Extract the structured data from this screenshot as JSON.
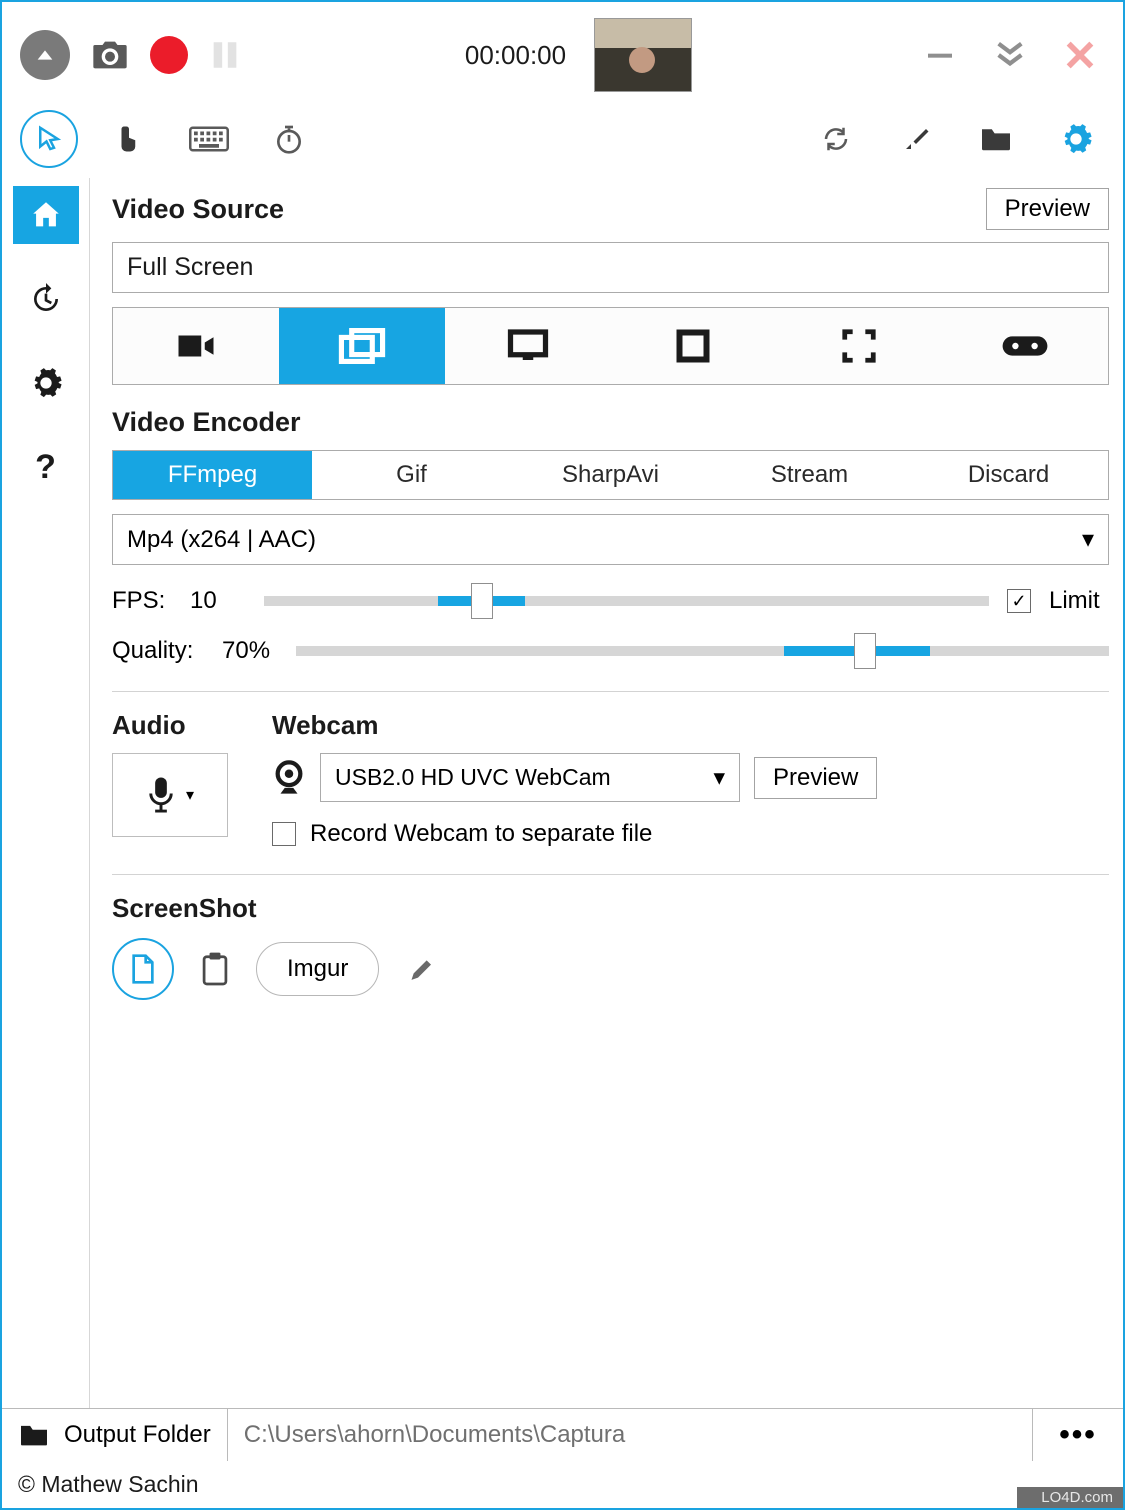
{
  "top": {
    "timer": "00:00:00"
  },
  "sections": {
    "video_source": {
      "title": "Video Source",
      "preview": "Preview",
      "value": "Full Screen"
    },
    "video_encoder": {
      "title": "Video Encoder",
      "tabs": [
        "FFmpeg",
        "Gif",
        "SharpAvi",
        "Stream",
        "Discard"
      ],
      "codec": "Mp4 (x264 | AAC)"
    },
    "fps": {
      "label": "FPS:",
      "value": "10",
      "limit_label": "Limit",
      "limit_checked": true,
      "percent": 30
    },
    "quality": {
      "label": "Quality:",
      "value": "70%",
      "percent": 70
    },
    "audio": {
      "title": "Audio"
    },
    "webcam": {
      "title": "Webcam",
      "device": "USB2.0 HD UVC WebCam",
      "preview": "Preview",
      "separate_label": "Record Webcam to separate file"
    },
    "screenshot": {
      "title": "ScreenShot",
      "imgur": "Imgur"
    }
  },
  "footer": {
    "folder_label": "Output Folder",
    "path": "C:\\Users\\ahorn\\Documents\\Captura",
    "copyright": "© Mathew Sachin",
    "watermark": "LO4D.com"
  }
}
